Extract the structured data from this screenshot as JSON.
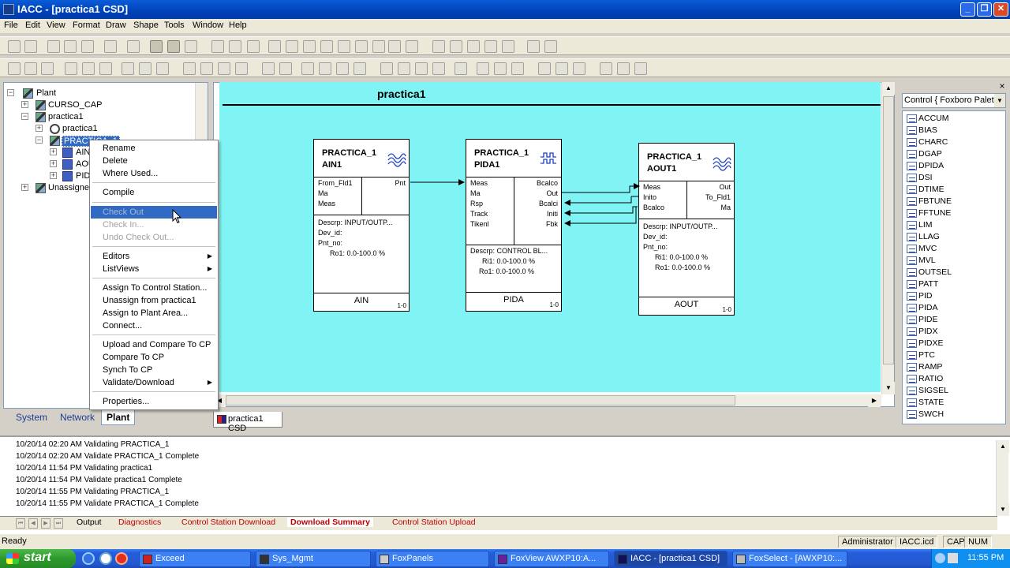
{
  "window": {
    "title": "IACC - [practica1 CSD]"
  },
  "menubar": [
    "File",
    "Edit",
    "View",
    "Format",
    "Draw",
    "Shape",
    "Tools",
    "Window",
    "Help"
  ],
  "tree": {
    "plant": "Plant",
    "curso": "CURSO_CAP",
    "practica1": "practica1",
    "practica1_station": "practica1",
    "practica1_block": "PRACTICA_1",
    "ain": "AIN",
    "aout": "AOU",
    "pid": "PID",
    "unassigned": "Unassigned"
  },
  "left_tabs": {
    "system": "System",
    "network": "Network",
    "plant": "Plant"
  },
  "context_menu": {
    "rename": "Rename",
    "delete": "Delete",
    "where_used": "Where Used...",
    "compile": "Compile",
    "check_out": "Check Out",
    "check_in": "Check In...",
    "undo_check_out": "Undo Check Out...",
    "editors": "Editors",
    "listviews": "ListViews",
    "assign_station": "Assign To Control Station...",
    "unassign": "Unassign from practica1",
    "assign_plant": "Assign to Plant Area...",
    "connect": "Connect...",
    "upload_compare": "Upload and Compare To CP",
    "compare": "Compare To CP",
    "synch": "Synch To CP",
    "validate": "Validate/Download",
    "properties": "Properties..."
  },
  "diagram": {
    "title": "practica1",
    "ain": {
      "name1": "PRACTICA_1",
      "name2": "AIN1",
      "in1": "From_Fld1",
      "in2": "Ma",
      "in3": "Meas",
      "out1": "Pnt",
      "a1": "Descrp:  INPUT/OUTP...",
      "a2": "Dev_id:",
      "a3": "Pnt_no:",
      "a4": "Ro1:  0.0-100.0 %",
      "type": "AIN",
      "num": "1-0"
    },
    "pida": {
      "name1": "PRACTICA_1",
      "name2": "PIDA1",
      "in1": "Meas",
      "in2": "Ma",
      "in3": "Rsp",
      "in4": "Track",
      "in5": "Tikenl",
      "out1": "Bcalco",
      "out2": "Out",
      "out3": "Bcalci",
      "out4": "Initi",
      "out5": "Fbk",
      "a1": "Descrp:  CONTROL BL...",
      "a2": "Ri1:  0.0-100.0 %",
      "a3": "Ro1:  0.0-100.0 %",
      "type": "PIDA",
      "num": "1-0"
    },
    "aout": {
      "name1": "PRACTICA_1",
      "name2": "AOUT1",
      "in1": "Meas",
      "in2": "Inito",
      "in3": "Bcalco",
      "out1": "Out",
      "out2": "To_Fld1",
      "out3": "Ma",
      "a1": "Descrp:  INPUT/OUTP...",
      "a2": "Dev_id:",
      "a3": "Pnt_no:",
      "a4": "Ri1:  0.0-100.0 %",
      "a5": "Ro1:  0.0-100.0 %",
      "type": "AOUT",
      "num": "1-0"
    }
  },
  "canvas_tab": "practica1 CSD",
  "palette": {
    "combo": "Control  { Foxboro Palett",
    "items": [
      "ACCUM",
      "BIAS",
      "CHARC",
      "DGAP",
      "DPIDA",
      "DSI",
      "DTIME",
      "FBTUNE",
      "FFTUNE",
      "LIM",
      "LLAG",
      "MVC",
      "MVL",
      "OUTSEL",
      "PATT",
      "PID",
      "PIDA",
      "PIDE",
      "PIDX",
      "PIDXE",
      "PTC",
      "RAMP",
      "RATIO",
      "SIGSEL",
      "STATE",
      "SWCH"
    ],
    "selected": "PIDA"
  },
  "log": [
    "10/20/14 02:20 AM  Validating PRACTICA_1",
    "10/20/14 02:20 AM  Validate PRACTICA_1 Complete",
    "10/20/14 11:54 PM  Validating practica1",
    "10/20/14 11:54 PM  Validate practica1 Complete",
    "10/20/14 11:55 PM  Validating PRACTICA_1",
    "10/20/14 11:55 PM  Validate PRACTICA_1 Complete"
  ],
  "output_tabs": {
    "output": "Output",
    "diagnostics": "Diagnostics",
    "csd": "Control Station Download",
    "ds": "Download Summary",
    "csu": "Control Station Upload"
  },
  "status": {
    "ready": "Ready",
    "user": "Administrator",
    "db": "IACC.icd",
    "cap": "CAP",
    "num": "NUM"
  },
  "taskbar": {
    "start": "start",
    "tasks": [
      "Exceed",
      "Sys_Mgmt",
      "FoxPanels",
      "FoxView AWXP10:A...",
      "IACC - [practica1 CSD]",
      "FoxSelect - [AWXP10:..."
    ],
    "clock": "11:55 PM"
  },
  "colors": {
    "canvas": "#80f4f4",
    "selection": "#316ac5",
    "titlebar": "#0a5cd8",
    "taskbar": "#245edb"
  }
}
